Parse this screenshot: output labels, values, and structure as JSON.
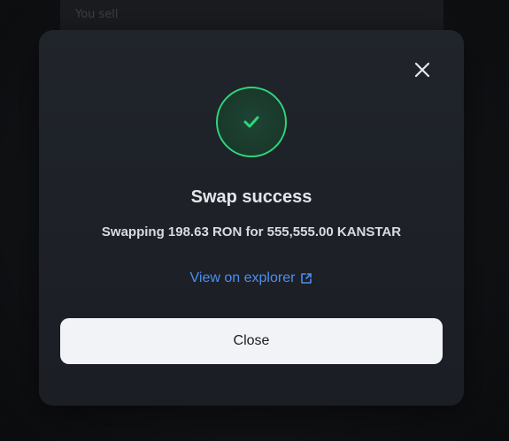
{
  "background": {
    "sell_label": "You sell"
  },
  "modal": {
    "title": "Swap success",
    "message": "Swapping 198.63 RON for 555,555.00 KANSTAR",
    "explorer_link": "View on explorer",
    "close_button": "Close",
    "close_icon": "close-icon",
    "status_icon": "checkmark-icon"
  },
  "colors": {
    "success": "#2fd57a",
    "link": "#4d8ef0",
    "button_bg": "#f1f3f7"
  }
}
